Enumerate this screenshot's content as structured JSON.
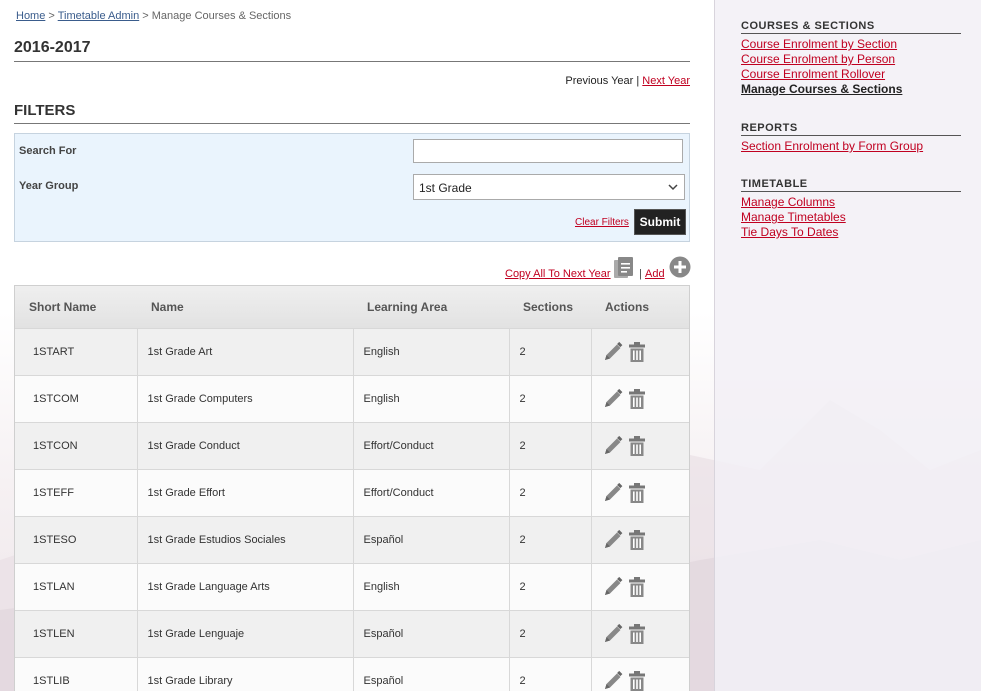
{
  "breadcrumb": {
    "home": "Home",
    "sep1": " > ",
    "timetable_admin": "Timetable Admin",
    "current": " > Manage Courses & Sections"
  },
  "page_title": "2016-2017",
  "year_nav": {
    "previous": "Previous Year",
    "sep": " | ",
    "next": "Next Year"
  },
  "filters": {
    "title": "FILTERS",
    "search_label": "Search For",
    "search_value": "",
    "year_group_label": "Year Group",
    "year_group_value": "1st Grade",
    "clear_label": "Clear Filters",
    "submit_label": "Submit"
  },
  "table_actions": {
    "copy_label": "Copy All To Next Year",
    "sep": "|",
    "add_label": "Add"
  },
  "table": {
    "headers": [
      "Short Name",
      "Name",
      "Learning Area",
      "Sections",
      "Actions"
    ],
    "rows": [
      {
        "short": "1START",
        "name": "1st Grade Art",
        "area": "English",
        "sections": "2"
      },
      {
        "short": "1STCOM",
        "name": "1st Grade Computers",
        "area": "English",
        "sections": "2"
      },
      {
        "short": "1STCON",
        "name": "1st Grade Conduct",
        "area": "Effort/Conduct",
        "sections": "2"
      },
      {
        "short": "1STEFF",
        "name": "1st Grade Effort",
        "area": "Effort/Conduct",
        "sections": "2"
      },
      {
        "short": "1STESO",
        "name": "1st Grade Estudios Sociales",
        "area": "Español",
        "sections": "2"
      },
      {
        "short": "1STLAN",
        "name": "1st Grade Language Arts",
        "area": "English",
        "sections": "2"
      },
      {
        "short": "1STLEN",
        "name": "1st Grade Lenguaje",
        "area": "Español",
        "sections": "2"
      },
      {
        "short": "1STLIB",
        "name": "1st Grade Library",
        "area": "Español",
        "sections": "2"
      }
    ]
  },
  "sidebar": {
    "courses": {
      "title": "COURSES & SECTIONS",
      "links": [
        "Course Enrolment by Section",
        "Course Enrolment by Person",
        "Course Enrolment Rollover",
        "Manage Courses & Sections"
      ]
    },
    "reports": {
      "title": "REPORTS",
      "links": [
        "Section Enrolment by Form Group"
      ]
    },
    "timetable": {
      "title": "TIMETABLE",
      "links": [
        "Manage Columns",
        "Manage Timetables",
        "Tie Days To Dates"
      ]
    }
  },
  "colors": {
    "link": "#c00020",
    "breadcrumb_link": "#3a5c8c",
    "submit_bg": "#222222",
    "filter_bg": "#eaf4fd"
  }
}
